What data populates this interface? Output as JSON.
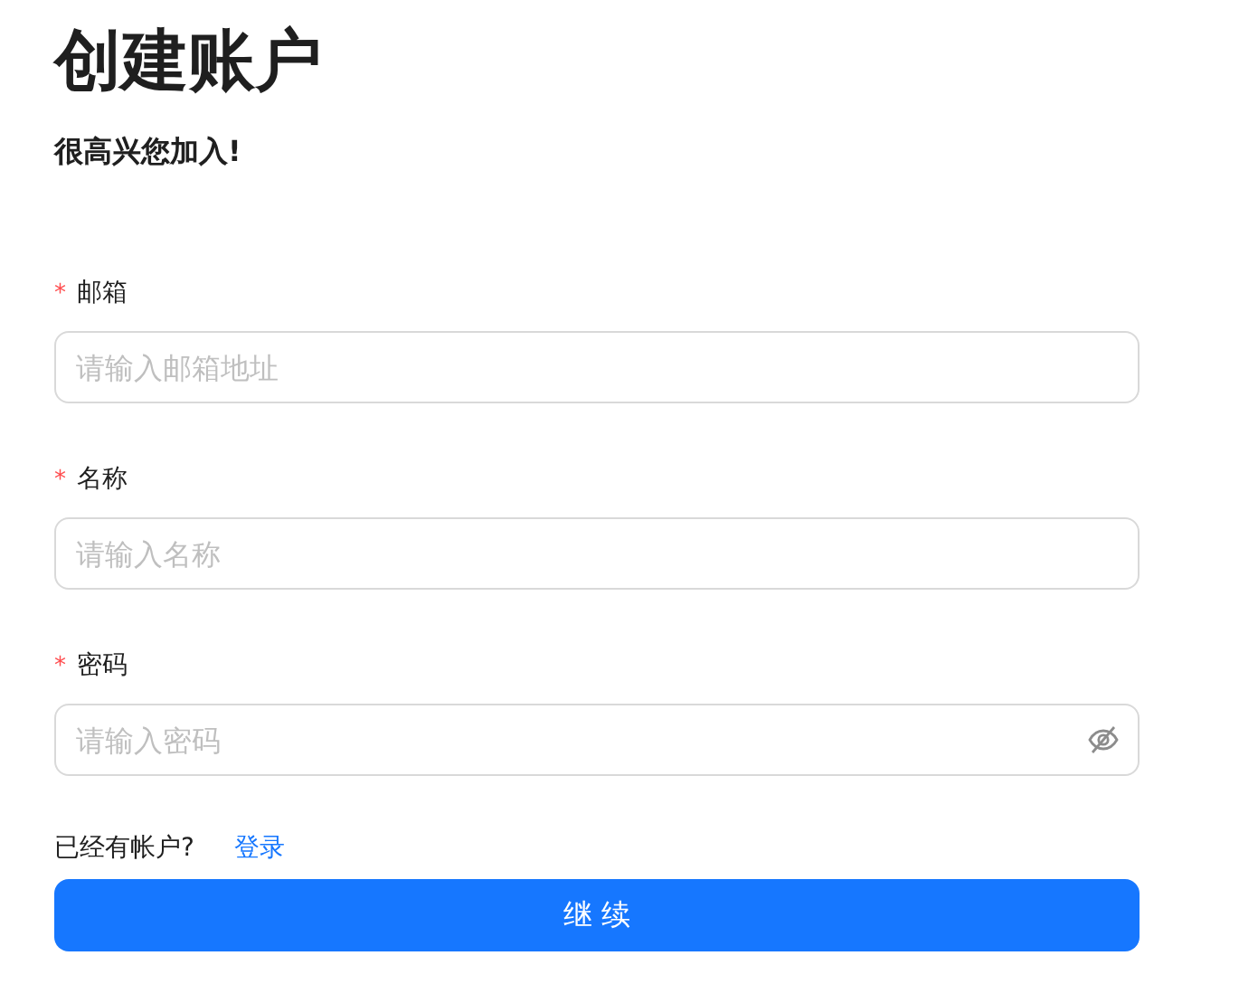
{
  "title": "创建账户",
  "subtitle": "很高兴您加入!",
  "fields": [
    {
      "kind": "text",
      "required_mark": "*",
      "label": "邮箱",
      "placeholder": "请输入邮箱地址"
    },
    {
      "kind": "text",
      "required_mark": "*",
      "label": "名称",
      "placeholder": "请输入名称"
    },
    {
      "kind": "password",
      "required_mark": "*",
      "label": "密码",
      "placeholder": "请输入密码"
    }
  ],
  "login_prompt": {
    "text": "已经有帐户?",
    "link": "登录"
  },
  "submit_button": "继 续"
}
